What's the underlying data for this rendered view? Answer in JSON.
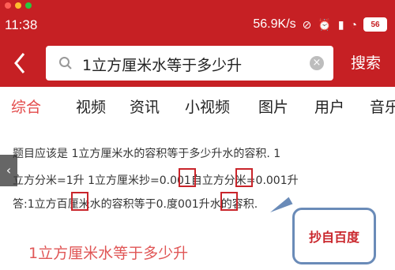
{
  "status_bar": {
    "time": "11:38",
    "speed": "56.9K/s",
    "battery": "56"
  },
  "search": {
    "query": "1立方厘米水等于多少升",
    "button_label": "搜索"
  },
  "tabs": [
    "综合",
    "视频",
    "资讯",
    "小视频",
    "图片",
    "用户",
    "音乐"
  ],
  "answer": {
    "line1": "题目应该是 1立方厘米水的容积等于多少升水的容积. 1",
    "line2": "立方分米=1升 1立方厘米抄=0.001自立方分米=0.001升",
    "line3": "答:1立方百厘米水的容积等于0.度001升水的容积."
  },
  "callout": "抄自百度",
  "result_title": "1立方厘米水等于多少升",
  "colors": {
    "header_red": "#c62024",
    "active_tab": "#e34a4a",
    "highlight_red": "#c9252b",
    "callout_border": "#6a8bb8"
  }
}
